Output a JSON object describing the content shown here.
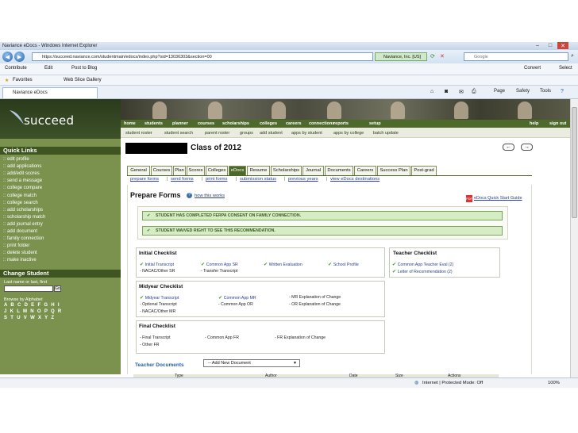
{
  "browser": {
    "window_title": "Naviance eDocs - Windows Internet Explorer",
    "url": "https://succeed.naviance.com/studentmain/edocs/index.php?sid=13036303&section=00",
    "security_label": "Naviance, Inc. [US]",
    "search_placeholder": "Google",
    "toolbar": {
      "contribute": "Contribute",
      "edit": "Edit",
      "post_to_blog": "Post to Blog",
      "convert": "Convert",
      "select": "Select",
      "favorites": "Favorites",
      "web_slice": "Web Slice Gallery",
      "page": "Page",
      "safety": "Safety",
      "tools": "Tools"
    },
    "tab_label": "Naviance eDocs",
    "status": {
      "zone": "Internet | Protected Mode: Off",
      "zoom": "100%"
    }
  },
  "site": {
    "logo_text": "succeed",
    "topnav": [
      "home",
      "students",
      "planner",
      "courses",
      "scholarships",
      "colleges",
      "careers",
      "connections",
      "reports",
      "setup"
    ],
    "topnav_right": [
      "help",
      "sign out"
    ],
    "subnav": [
      "student roster",
      "student search",
      "parent roster",
      "groups",
      "add student",
      "apps by student",
      "apps by college",
      "batch update"
    ]
  },
  "sidebar": {
    "quick_links_title": "Quick Links",
    "links": [
      ":: edit profile",
      ":: add applications",
      ":: add/edit scores",
      ":: send a message",
      ":: college compare",
      ":: college match",
      ":: college search",
      ":: add scholarships",
      ":: scholarship match",
      ":: add journal entry",
      ":: add document",
      ":: family connection",
      ":: print folder",
      ":: delete student",
      ":: make inactive"
    ],
    "change_student_title": "Change Student",
    "change_student_label": "Last name or last, first",
    "go_label": "Go",
    "alpha_label": "Browse by Alphabet",
    "alpha_rows": [
      "A B C D E F G H I",
      "J K L M N O P Q R",
      "S T U V W X Y Z"
    ]
  },
  "main": {
    "class_title": "Class of 2012",
    "prev_label": "←",
    "next_label": "→",
    "tabs": [
      "General",
      "Courses",
      "Plan",
      "Scores",
      "Colleges",
      "eDocs",
      "Resume",
      "Scholarships",
      "Journal",
      "Documents",
      "Careers",
      "Success Plan",
      "Post-grad"
    ],
    "subtabs": [
      "prepare forms",
      "send forms",
      "print forms",
      "submission status",
      "previous years",
      "view eDocs destinations"
    ],
    "prepare_title": "Prepare Forms",
    "how_link": "how this works",
    "quick_start": "eDocs Quick Start Guide",
    "alerts": [
      "STUDENT HAS COMPLETED FERPA CONSENT ON FAMILY CONNECTION.",
      "STUDENT WAIVED RIGHT TO SEE THIS RECOMMENDATION."
    ],
    "initial": {
      "title": "Initial Checklist",
      "done": [
        "Initial Transcript",
        "Common App SR",
        "Written Evaluation",
        "School Profile"
      ],
      "pending": [
        "- NACAC/Other SR",
        "- Transfer Transcript"
      ]
    },
    "teacher": {
      "title": "Teacher Checklist",
      "done": [
        "Common App Teacher Eval (2)",
        "Letter of Recommendation (2)"
      ]
    },
    "midyear": {
      "title": "Midyear Checklist",
      "done": [
        "Midyear Transcript",
        "Common App MR"
      ],
      "pending": [
        "- MR Explanation of Change",
        "- Optional Transcript",
        "- Common App OR",
        "- OR Explanation of Change",
        "- NACAC/Other MR"
      ]
    },
    "final": {
      "title": "Final Checklist",
      "pending": [
        "- Final Transcript",
        "- Common App FR",
        "- FR Explanation of Change",
        "- Other FR"
      ]
    },
    "teacher_docs_label": "Teacher Documents",
    "add_doc_select": "-- Add New Document",
    "doc_columns": [
      "Type",
      "Author",
      "Date",
      "Size",
      "Actions"
    ]
  }
}
